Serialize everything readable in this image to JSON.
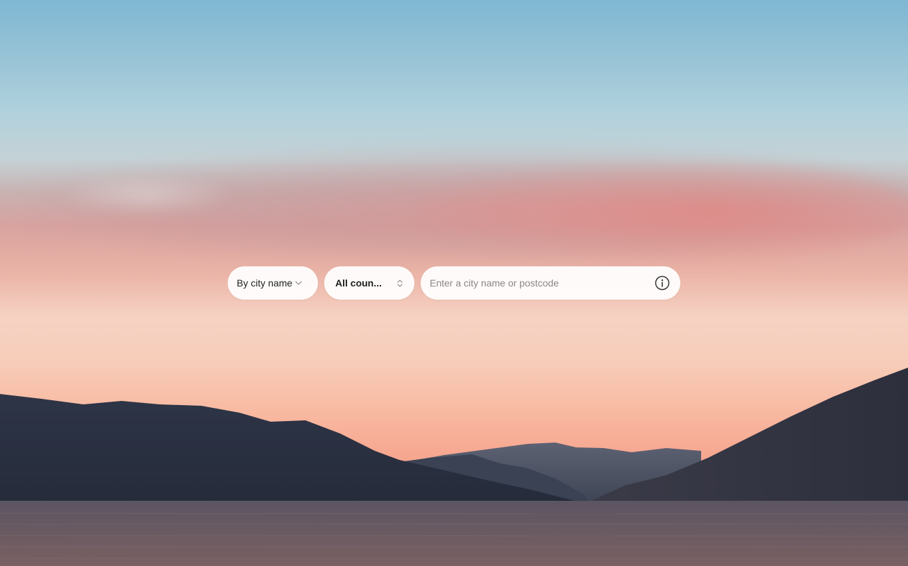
{
  "search": {
    "mode_label": "By city name",
    "country_label": "All coun...",
    "city_placeholder": "Enter a city name or postcode",
    "city_value": ""
  },
  "icons": {
    "mode_chevron": "chevron-down-icon",
    "country_toggle": "chevron-updown-icon",
    "info": "info-icon"
  },
  "colors": {
    "pill_background": "#ffffff",
    "text": "#222222",
    "placeholder": "#8a8786"
  }
}
